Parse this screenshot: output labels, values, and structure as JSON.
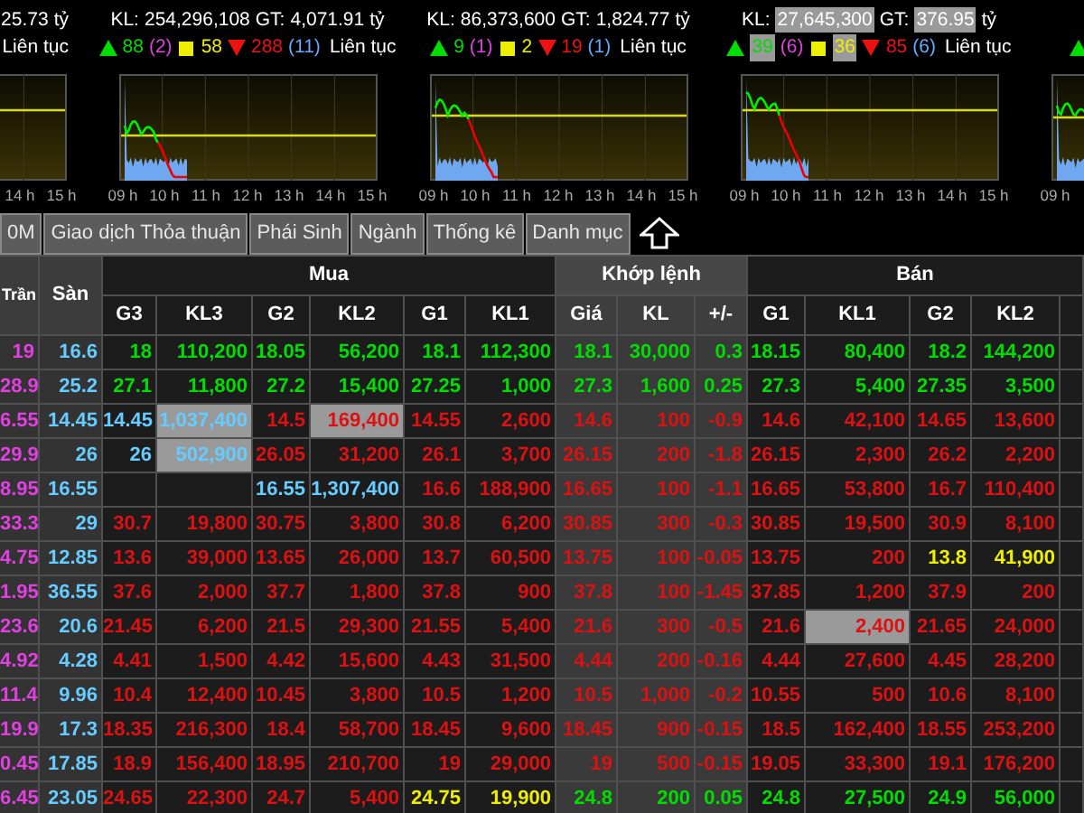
{
  "index_panels": [
    {
      "kind": "partial_left",
      "value": "25.73",
      "unit": "tỷ",
      "status": "Liên tục",
      "times": [
        "14 h",
        "15 h"
      ]
    },
    {
      "kind": "full",
      "volume_label": "KL:",
      "volume": "254,296,108",
      "volume_highlighted": false,
      "value_label": "GT:",
      "value": "4,071.91",
      "value_highlighted": false,
      "unit": "tỷ",
      "up": "88",
      "up_highlighted": false,
      "ceiling": "(2)",
      "unchanged": "58",
      "unchanged_highlighted": false,
      "down": "288",
      "floor": "(11)",
      "status": "Liên tục",
      "times": [
        "09 h",
        "10 h",
        "11 h",
        "12 h",
        "13 h",
        "14 h",
        "15 h"
      ]
    },
    {
      "kind": "full",
      "volume_label": "KL:",
      "volume": "86,373,600",
      "volume_highlighted": false,
      "value_label": "GT:",
      "value": "1,824.77",
      "value_highlighted": false,
      "unit": "tỷ",
      "up": "9",
      "up_highlighted": false,
      "ceiling": "(1)",
      "unchanged": "2",
      "unchanged_highlighted": false,
      "down": "19",
      "floor": "(1)",
      "status": "Liên tục",
      "times": [
        "09 h",
        "10 h",
        "11 h",
        "12 h",
        "13 h",
        "14 h",
        "15 h"
      ]
    },
    {
      "kind": "full",
      "volume_label": "KL:",
      "volume": "27,645,300",
      "volume_highlighted": true,
      "value_label": "GT:",
      "value": "376.95",
      "value_highlighted": true,
      "unit": "tỷ",
      "up": "39",
      "up_highlighted": true,
      "ceiling": "(6)",
      "unchanged": "36",
      "unchanged_highlighted": true,
      "down": "85",
      "floor": "(6)",
      "status": "Liên tục",
      "times": [
        "09 h",
        "10 h",
        "11 h",
        "12 h",
        "13 h",
        "14 h",
        "15 h"
      ]
    },
    {
      "kind": "partial_right",
      "times": [
        "09 h"
      ]
    }
  ],
  "tabs": [
    {
      "label": "0M",
      "selected": false
    },
    {
      "label": "Giao dịch Thỏa thuận",
      "selected": false
    },
    {
      "label": "Phái Sinh",
      "selected": false
    },
    {
      "label": "Ngành",
      "selected": false
    },
    {
      "label": "Thống kê",
      "selected": false
    },
    {
      "label": "Danh mục",
      "selected": false
    }
  ],
  "table": {
    "fixed_columns": [
      "Trần",
      "Sàn"
    ],
    "groups": [
      {
        "label": "Mua",
        "shaded": false,
        "columns": [
          "G3",
          "KL3",
          "G2",
          "KL2",
          "G1",
          "KL1"
        ]
      },
      {
        "label": "Khớp lệnh",
        "shaded": true,
        "columns": [
          "Giá",
          "KL",
          "+/-"
        ]
      },
      {
        "label": "Bán",
        "shaded": false,
        "columns": [
          "G1",
          "KL1",
          "G2",
          "KL2"
        ]
      }
    ],
    "rows": [
      {
        "cells": [
          {
            "text": "19",
            "color": "#e040e0",
            "highlighted": false
          },
          {
            "text": "16.6",
            "color": "#66ccff",
            "highlighted": false
          },
          {
            "text": "18",
            "color": "#00dd00",
            "highlighted": false
          },
          {
            "text": "110,200",
            "color": "#00dd00",
            "highlighted": false
          },
          {
            "text": "18.05",
            "color": "#00dd00",
            "highlighted": false
          },
          {
            "text": "56,200",
            "color": "#00dd00",
            "highlighted": false
          },
          {
            "text": "18.1",
            "color": "#00dd00",
            "highlighted": false
          },
          {
            "text": "112,300",
            "color": "#00dd00",
            "highlighted": false
          },
          {
            "text": "18.1",
            "color": "#00dd00",
            "highlighted": false
          },
          {
            "text": "30,000",
            "color": "#00dd00",
            "highlighted": false
          },
          {
            "text": "0.3",
            "color": "#00dd00",
            "highlighted": false
          },
          {
            "text": "18.15",
            "color": "#00dd00",
            "highlighted": false
          },
          {
            "text": "80,400",
            "color": "#00dd00",
            "highlighted": false
          },
          {
            "text": "18.2",
            "color": "#00dd00",
            "highlighted": false
          },
          {
            "text": "144,200",
            "color": "#00dd00",
            "highlighted": false
          }
        ]
      },
      {
        "cells": [
          {
            "text": "28.9",
            "color": "#e040e0",
            "highlighted": false
          },
          {
            "text": "25.2",
            "color": "#66ccff",
            "highlighted": false
          },
          {
            "text": "27.1",
            "color": "#00dd00",
            "highlighted": false
          },
          {
            "text": "11,800",
            "color": "#00dd00",
            "highlighted": false
          },
          {
            "text": "27.2",
            "color": "#00dd00",
            "highlighted": false
          },
          {
            "text": "15,400",
            "color": "#00dd00",
            "highlighted": false
          },
          {
            "text": "27.25",
            "color": "#00dd00",
            "highlighted": false
          },
          {
            "text": "1,000",
            "color": "#00dd00",
            "highlighted": false
          },
          {
            "text": "27.3",
            "color": "#00dd00",
            "highlighted": false
          },
          {
            "text": "1,600",
            "color": "#00dd00",
            "highlighted": false
          },
          {
            "text": "0.25",
            "color": "#00dd00",
            "highlighted": false
          },
          {
            "text": "27.3",
            "color": "#00dd00",
            "highlighted": false
          },
          {
            "text": "5,400",
            "color": "#00dd00",
            "highlighted": false
          },
          {
            "text": "27.35",
            "color": "#00dd00",
            "highlighted": false
          },
          {
            "text": "3,500",
            "color": "#00dd00",
            "highlighted": false
          }
        ]
      },
      {
        "cells": [
          {
            "text": "6.55",
            "color": "#e040e0",
            "highlighted": false
          },
          {
            "text": "14.45",
            "color": "#66ccff",
            "highlighted": false
          },
          {
            "text": "14.45",
            "color": "#66ccff",
            "highlighted": false
          },
          {
            "text": "1,037,400",
            "color": "#66ccff",
            "highlighted": true
          },
          {
            "text": "14.5",
            "color": "#dd1111",
            "highlighted": false
          },
          {
            "text": "169,400",
            "color": "#dd1111",
            "highlighted": true
          },
          {
            "text": "14.55",
            "color": "#dd1111",
            "highlighted": false
          },
          {
            "text": "2,600",
            "color": "#dd1111",
            "highlighted": false
          },
          {
            "text": "14.6",
            "color": "#dd1111",
            "highlighted": false
          },
          {
            "text": "100",
            "color": "#dd1111",
            "highlighted": false
          },
          {
            "text": "-0.9",
            "color": "#dd1111",
            "highlighted": false
          },
          {
            "text": "14.6",
            "color": "#dd1111",
            "highlighted": false
          },
          {
            "text": "42,100",
            "color": "#dd1111",
            "highlighted": false
          },
          {
            "text": "14.65",
            "color": "#dd1111",
            "highlighted": false
          },
          {
            "text": "13,600",
            "color": "#dd1111",
            "highlighted": false
          }
        ]
      },
      {
        "cells": [
          {
            "text": "29.9",
            "color": "#e040e0",
            "highlighted": false
          },
          {
            "text": "26",
            "color": "#66ccff",
            "highlighted": false
          },
          {
            "text": "26",
            "color": "#66ccff",
            "highlighted": false
          },
          {
            "text": "502,900",
            "color": "#66ccff",
            "highlighted": true
          },
          {
            "text": "26.05",
            "color": "#dd1111",
            "highlighted": false
          },
          {
            "text": "31,200",
            "color": "#dd1111",
            "highlighted": false
          },
          {
            "text": "26.1",
            "color": "#dd1111",
            "highlighted": false
          },
          {
            "text": "3,700",
            "color": "#dd1111",
            "highlighted": false
          },
          {
            "text": "26.15",
            "color": "#dd1111",
            "highlighted": false
          },
          {
            "text": "200",
            "color": "#dd1111",
            "highlighted": false
          },
          {
            "text": "-1.8",
            "color": "#dd1111",
            "highlighted": false
          },
          {
            "text": "26.15",
            "color": "#dd1111",
            "highlighted": false
          },
          {
            "text": "2,300",
            "color": "#dd1111",
            "highlighted": false
          },
          {
            "text": "26.2",
            "color": "#dd1111",
            "highlighted": false
          },
          {
            "text": "2,200",
            "color": "#dd1111",
            "highlighted": false
          }
        ]
      },
      {
        "cells": [
          {
            "text": "8.95",
            "color": "#e040e0",
            "highlighted": false
          },
          {
            "text": "16.55",
            "color": "#66ccff",
            "highlighted": false
          },
          null,
          null,
          {
            "text": "16.55",
            "color": "#66ccff",
            "highlighted": false
          },
          {
            "text": "1,307,400",
            "color": "#66ccff",
            "highlighted": false
          },
          {
            "text": "16.6",
            "color": "#dd1111",
            "highlighted": false
          },
          {
            "text": "188,900",
            "color": "#dd1111",
            "highlighted": false
          },
          {
            "text": "16.65",
            "color": "#dd1111",
            "highlighted": false
          },
          {
            "text": "100",
            "color": "#dd1111",
            "highlighted": false
          },
          {
            "text": "-1.1",
            "color": "#dd1111",
            "highlighted": false
          },
          {
            "text": "16.65",
            "color": "#dd1111",
            "highlighted": false
          },
          {
            "text": "53,800",
            "color": "#dd1111",
            "highlighted": false
          },
          {
            "text": "16.7",
            "color": "#dd1111",
            "highlighted": false
          },
          {
            "text": "110,400",
            "color": "#dd1111",
            "highlighted": false
          }
        ]
      },
      {
        "cells": [
          {
            "text": "33.3",
            "color": "#e040e0",
            "highlighted": false
          },
          {
            "text": "29",
            "color": "#66ccff",
            "highlighted": false
          },
          {
            "text": "30.7",
            "color": "#dd1111",
            "highlighted": false
          },
          {
            "text": "19,800",
            "color": "#dd1111",
            "highlighted": false
          },
          {
            "text": "30.75",
            "color": "#dd1111",
            "highlighted": false
          },
          {
            "text": "3,800",
            "color": "#dd1111",
            "highlighted": false
          },
          {
            "text": "30.8",
            "color": "#dd1111",
            "highlighted": false
          },
          {
            "text": "6,200",
            "color": "#dd1111",
            "highlighted": false
          },
          {
            "text": "30.85",
            "color": "#dd1111",
            "highlighted": false
          },
          {
            "text": "300",
            "color": "#dd1111",
            "highlighted": false
          },
          {
            "text": "-0.3",
            "color": "#dd1111",
            "highlighted": false
          },
          {
            "text": "30.85",
            "color": "#dd1111",
            "highlighted": false
          },
          {
            "text": "19,500",
            "color": "#dd1111",
            "highlighted": false
          },
          {
            "text": "30.9",
            "color": "#dd1111",
            "highlighted": false
          },
          {
            "text": "8,100",
            "color": "#dd1111",
            "highlighted": false
          }
        ]
      },
      {
        "cells": [
          {
            "text": "4.75",
            "color": "#e040e0",
            "highlighted": false
          },
          {
            "text": "12.85",
            "color": "#66ccff",
            "highlighted": false
          },
          {
            "text": "13.6",
            "color": "#dd1111",
            "highlighted": false
          },
          {
            "text": "39,000",
            "color": "#dd1111",
            "highlighted": false
          },
          {
            "text": "13.65",
            "color": "#dd1111",
            "highlighted": false
          },
          {
            "text": "26,000",
            "color": "#dd1111",
            "highlighted": false
          },
          {
            "text": "13.7",
            "color": "#dd1111",
            "highlighted": false
          },
          {
            "text": "60,500",
            "color": "#dd1111",
            "highlighted": false
          },
          {
            "text": "13.75",
            "color": "#dd1111",
            "highlighted": false
          },
          {
            "text": "100",
            "color": "#dd1111",
            "highlighted": false
          },
          {
            "text": "-0.05",
            "color": "#dd1111",
            "highlighted": false
          },
          {
            "text": "13.75",
            "color": "#dd1111",
            "highlighted": false
          },
          {
            "text": "200",
            "color": "#dd1111",
            "highlighted": false
          },
          {
            "text": "13.8",
            "color": "#eeee00",
            "highlighted": false
          },
          {
            "text": "41,900",
            "color": "#eeee00",
            "highlighted": false
          }
        ]
      },
      {
        "cells": [
          {
            "text": "1.95",
            "color": "#e040e0",
            "highlighted": false
          },
          {
            "text": "36.55",
            "color": "#66ccff",
            "highlighted": false
          },
          {
            "text": "37.6",
            "color": "#dd1111",
            "highlighted": false
          },
          {
            "text": "2,000",
            "color": "#dd1111",
            "highlighted": false
          },
          {
            "text": "37.7",
            "color": "#dd1111",
            "highlighted": false
          },
          {
            "text": "1,800",
            "color": "#dd1111",
            "highlighted": false
          },
          {
            "text": "37.8",
            "color": "#dd1111",
            "highlighted": false
          },
          {
            "text": "900",
            "color": "#dd1111",
            "highlighted": false
          },
          {
            "text": "37.8",
            "color": "#dd1111",
            "highlighted": false
          },
          {
            "text": "100",
            "color": "#dd1111",
            "highlighted": false
          },
          {
            "text": "-1.45",
            "color": "#dd1111",
            "highlighted": false
          },
          {
            "text": "37.85",
            "color": "#dd1111",
            "highlighted": false
          },
          {
            "text": "1,200",
            "color": "#dd1111",
            "highlighted": false
          },
          {
            "text": "37.9",
            "color": "#dd1111",
            "highlighted": false
          },
          {
            "text": "200",
            "color": "#dd1111",
            "highlighted": false
          }
        ]
      },
      {
        "cells": [
          {
            "text": "23.6",
            "color": "#e040e0",
            "highlighted": false
          },
          {
            "text": "20.6",
            "color": "#66ccff",
            "highlighted": false
          },
          {
            "text": "21.45",
            "color": "#dd1111",
            "highlighted": false
          },
          {
            "text": "6,200",
            "color": "#dd1111",
            "highlighted": false
          },
          {
            "text": "21.5",
            "color": "#dd1111",
            "highlighted": false
          },
          {
            "text": "29,300",
            "color": "#dd1111",
            "highlighted": false
          },
          {
            "text": "21.55",
            "color": "#dd1111",
            "highlighted": false
          },
          {
            "text": "5,400",
            "color": "#dd1111",
            "highlighted": false
          },
          {
            "text": "21.6",
            "color": "#dd1111",
            "highlighted": false
          },
          {
            "text": "300",
            "color": "#dd1111",
            "highlighted": false
          },
          {
            "text": "-0.5",
            "color": "#dd1111",
            "highlighted": false
          },
          {
            "text": "21.6",
            "color": "#dd1111",
            "highlighted": false
          },
          {
            "text": "2,400",
            "color": "#dd1111",
            "highlighted": true
          },
          {
            "text": "21.65",
            "color": "#dd1111",
            "highlighted": false
          },
          {
            "text": "24,000",
            "color": "#dd1111",
            "highlighted": false
          }
        ]
      },
      {
        "cells": [
          {
            "text": "4.92",
            "color": "#e040e0",
            "highlighted": false
          },
          {
            "text": "4.28",
            "color": "#66ccff",
            "highlighted": false
          },
          {
            "text": "4.41",
            "color": "#dd1111",
            "highlighted": false
          },
          {
            "text": "1,500",
            "color": "#dd1111",
            "highlighted": false
          },
          {
            "text": "4.42",
            "color": "#dd1111",
            "highlighted": false
          },
          {
            "text": "15,600",
            "color": "#dd1111",
            "highlighted": false
          },
          {
            "text": "4.43",
            "color": "#dd1111",
            "highlighted": false
          },
          {
            "text": "31,500",
            "color": "#dd1111",
            "highlighted": false
          },
          {
            "text": "4.44",
            "color": "#dd1111",
            "highlighted": false
          },
          {
            "text": "200",
            "color": "#dd1111",
            "highlighted": false
          },
          {
            "text": "-0.16",
            "color": "#dd1111",
            "highlighted": false
          },
          {
            "text": "4.44",
            "color": "#dd1111",
            "highlighted": false
          },
          {
            "text": "27,600",
            "color": "#dd1111",
            "highlighted": false
          },
          {
            "text": "4.45",
            "color": "#dd1111",
            "highlighted": false
          },
          {
            "text": "28,200",
            "color": "#dd1111",
            "highlighted": false
          }
        ]
      },
      {
        "cells": [
          {
            "text": "11.4",
            "color": "#e040e0",
            "highlighted": false
          },
          {
            "text": "9.96",
            "color": "#66ccff",
            "highlighted": false
          },
          {
            "text": "10.4",
            "color": "#dd1111",
            "highlighted": false
          },
          {
            "text": "12,400",
            "color": "#dd1111",
            "highlighted": false
          },
          {
            "text": "10.45",
            "color": "#dd1111",
            "highlighted": false
          },
          {
            "text": "3,800",
            "color": "#dd1111",
            "highlighted": false
          },
          {
            "text": "10.5",
            "color": "#dd1111",
            "highlighted": false
          },
          {
            "text": "1,200",
            "color": "#dd1111",
            "highlighted": false
          },
          {
            "text": "10.5",
            "color": "#dd1111",
            "highlighted": false
          },
          {
            "text": "1,000",
            "color": "#dd1111",
            "highlighted": false
          },
          {
            "text": "-0.2",
            "color": "#dd1111",
            "highlighted": false
          },
          {
            "text": "10.55",
            "color": "#dd1111",
            "highlighted": false
          },
          {
            "text": "500",
            "color": "#dd1111",
            "highlighted": false
          },
          {
            "text": "10.6",
            "color": "#dd1111",
            "highlighted": false
          },
          {
            "text": "8,100",
            "color": "#dd1111",
            "highlighted": false
          }
        ]
      },
      {
        "cells": [
          {
            "text": "19.9",
            "color": "#e040e0",
            "highlighted": false
          },
          {
            "text": "17.3",
            "color": "#66ccff",
            "highlighted": false
          },
          {
            "text": "18.35",
            "color": "#dd1111",
            "highlighted": false
          },
          {
            "text": "216,300",
            "color": "#dd1111",
            "highlighted": false
          },
          {
            "text": "18.4",
            "color": "#dd1111",
            "highlighted": false
          },
          {
            "text": "58,700",
            "color": "#dd1111",
            "highlighted": false
          },
          {
            "text": "18.45",
            "color": "#dd1111",
            "highlighted": false
          },
          {
            "text": "9,600",
            "color": "#dd1111",
            "highlighted": false
          },
          {
            "text": "18.45",
            "color": "#dd1111",
            "highlighted": false
          },
          {
            "text": "900",
            "color": "#dd1111",
            "highlighted": false
          },
          {
            "text": "-0.15",
            "color": "#dd1111",
            "highlighted": false
          },
          {
            "text": "18.5",
            "color": "#dd1111",
            "highlighted": false
          },
          {
            "text": "162,400",
            "color": "#dd1111",
            "highlighted": false
          },
          {
            "text": "18.55",
            "color": "#dd1111",
            "highlighted": false
          },
          {
            "text": "253,200",
            "color": "#dd1111",
            "highlighted": false
          }
        ]
      },
      {
        "cells": [
          {
            "text": "0.45",
            "color": "#e040e0",
            "highlighted": false
          },
          {
            "text": "17.85",
            "color": "#66ccff",
            "highlighted": false
          },
          {
            "text": "18.9",
            "color": "#dd1111",
            "highlighted": false
          },
          {
            "text": "156,400",
            "color": "#dd1111",
            "highlighted": false
          },
          {
            "text": "18.95",
            "color": "#dd1111",
            "highlighted": false
          },
          {
            "text": "210,700",
            "color": "#dd1111",
            "highlighted": false
          },
          {
            "text": "19",
            "color": "#dd1111",
            "highlighted": false
          },
          {
            "text": "29,000",
            "color": "#dd1111",
            "highlighted": false
          },
          {
            "text": "19",
            "color": "#dd1111",
            "highlighted": false
          },
          {
            "text": "500",
            "color": "#dd1111",
            "highlighted": false
          },
          {
            "text": "-0.15",
            "color": "#dd1111",
            "highlighted": false
          },
          {
            "text": "19.05",
            "color": "#dd1111",
            "highlighted": false
          },
          {
            "text": "33,300",
            "color": "#dd1111",
            "highlighted": false
          },
          {
            "text": "19.1",
            "color": "#dd1111",
            "highlighted": false
          },
          {
            "text": "176,200",
            "color": "#dd1111",
            "highlighted": false
          }
        ]
      },
      {
        "cells": [
          {
            "text": "6.45",
            "color": "#e040e0",
            "highlighted": false
          },
          {
            "text": "23.05",
            "color": "#66ccff",
            "highlighted": false
          },
          {
            "text": "24.65",
            "color": "#dd1111",
            "highlighted": false
          },
          {
            "text": "22,300",
            "color": "#dd1111",
            "highlighted": false
          },
          {
            "text": "24.7",
            "color": "#dd1111",
            "highlighted": false
          },
          {
            "text": "5,400",
            "color": "#dd1111",
            "highlighted": false
          },
          {
            "text": "24.75",
            "color": "#eeee00",
            "highlighted": false
          },
          {
            "text": "19,900",
            "color": "#eeee00",
            "highlighted": false
          },
          {
            "text": "24.8",
            "color": "#00dd00",
            "highlighted": false
          },
          {
            "text": "200",
            "color": "#00dd00",
            "highlighted": false
          },
          {
            "text": "0.05",
            "color": "#00dd00",
            "highlighted": false
          },
          {
            "text": "24.8",
            "color": "#00dd00",
            "highlighted": false
          },
          {
            "text": "27,500",
            "color": "#00dd00",
            "highlighted": false
          },
          {
            "text": "24.9",
            "color": "#00dd00",
            "highlighted": false
          },
          {
            "text": "56,000",
            "color": "#00dd00",
            "highlighted": false
          }
        ]
      }
    ]
  }
}
